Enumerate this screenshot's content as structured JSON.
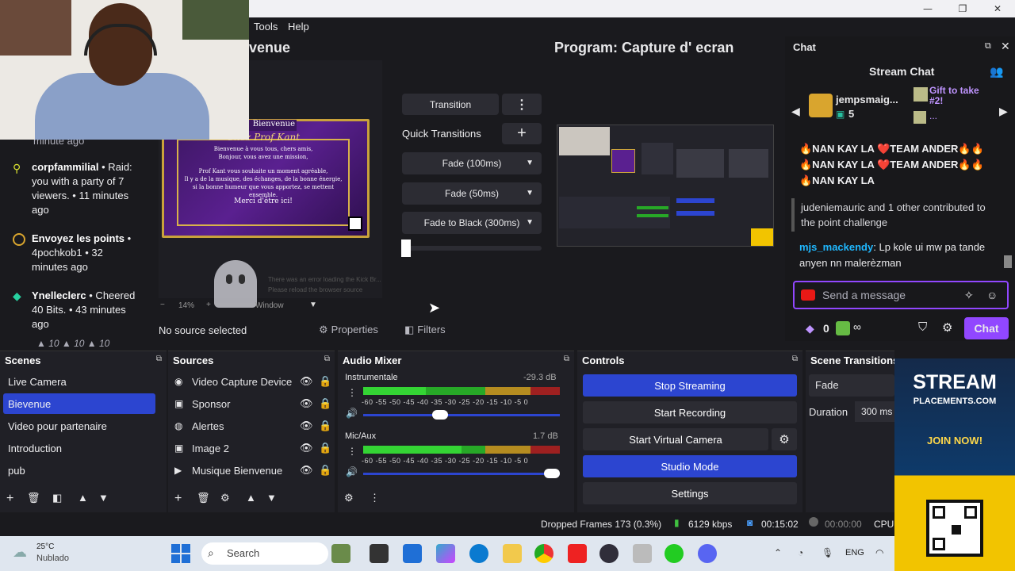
{
  "menu": {
    "tools": "Tools",
    "help": "Help"
  },
  "preview": {
    "title_partial": "venue",
    "zoom": "14%",
    "window_label": "Window",
    "card_header": "Bienvenue",
    "card_subtitle": "Chez Prof Kant",
    "card_lines": [
      "Bienvenue à vous tous, chers amis,",
      "Bonjour, vous avez une mission,",
      "Prof Kant vous souhaite un moment agréable,",
      "Il y a de la musique, des échanges, de la bonne énergie,",
      "si la bonne humeur que vous apportez, se mettent ensemble.",
      "Merci d'être ici!"
    ],
    "error_text": "There was an error loading the Kick Br...",
    "error_text2": "Please reload the browser source"
  },
  "transitions": {
    "transition_btn": "Transition",
    "quick_label": "Quick Transitions",
    "items": [
      "Fade (100ms)",
      "Fade (50ms)",
      "Fade to Black (300ms)"
    ]
  },
  "program": {
    "title": "Program: Capture d' ecran"
  },
  "chat": {
    "dock_title": "Chat",
    "header": "Stream Chat",
    "gift_user": "jempsmaig...",
    "gift_count": "5",
    "gift_text": "Gift to take #2!",
    "gift_dots": "...",
    "lines": [
      "🔥NAN KAY LA ❤️TEAM ANDER🔥🔥",
      "🔥NAN KAY LA ❤️TEAM ANDER🔥🔥",
      "🔥NAN KAY LA"
    ],
    "contrib": "judeniemauric and 1 other contributed to the point challenge",
    "msg_user": "mjs_mackendy",
    "msg_text": ": Lp kole ui mw pa tande anyen nn malerèzman",
    "input_placeholder": "Send a message",
    "points": "0",
    "infinity": "∞",
    "chat_button": "Chat"
  },
  "feed": [
    {
      "header": "minute ago"
    },
    {
      "name": "corpfammilial",
      "text": " • Raid: you with a party of 7 viewers. • 11 minutes ago"
    },
    {
      "name": "Envoyez les points",
      "text": " • 4pochkob1 • 32 minutes ago"
    },
    {
      "name": "Ynelleclerc",
      "text": " • Cheered 40 Bits. • 43 minutes ago"
    },
    {
      "footer": "▲ 10   ▲ 10   ▲ 10"
    }
  ],
  "no_source": "No source selected",
  "properties": "Properties",
  "filters": "Filters",
  "scenes": {
    "title": "Scenes",
    "items": [
      "Live Camera",
      "Bievenue",
      "Video pour partenaire",
      "Introduction",
      "pub"
    ],
    "active_index": 1
  },
  "sources": {
    "title": "Sources",
    "items": [
      "Video Capture Device",
      "Sponsor",
      "Alertes",
      "Image 2",
      "Musique Bienvenue"
    ]
  },
  "mixer": {
    "title": "Audio Mixer",
    "channels": [
      {
        "name": "Instrumentale",
        "db": "-29.3 dB",
        "level": 0.32,
        "volume": 0.38
      },
      {
        "name": "Mic/Aux",
        "db": "1.7 dB",
        "level": 0.5,
        "volume": 1.0
      }
    ],
    "scale": "-60 -55 -50 -45 -40 -35 -30 -25 -20 -15 -10 -5 0"
  },
  "controls": {
    "title": "Controls",
    "stop_streaming": "Stop Streaming",
    "start_recording": "Start Recording",
    "start_virtual_camera": "Start Virtual Camera",
    "studio_mode": "Studio Mode",
    "settings": "Settings"
  },
  "scene_transitions": {
    "title": "Scene Transitions",
    "value": "Fade",
    "duration_label": "Duration",
    "duration_value": "300 ms"
  },
  "status": {
    "dropped": "Dropped Frames 173 (0.3%)",
    "bitrate": "6129 kbps",
    "stream_time": "00:15:02",
    "rec_time": "00:00:00",
    "cpu": "CPU:"
  },
  "ad": {
    "line1": "STREAM",
    "line2": "PLACEMENTS.COM",
    "cta": "JOIN NOW!"
  },
  "taskbar": {
    "temp": "25°C",
    "weather": "Nublado",
    "search": "Search",
    "lang": "ENG"
  }
}
